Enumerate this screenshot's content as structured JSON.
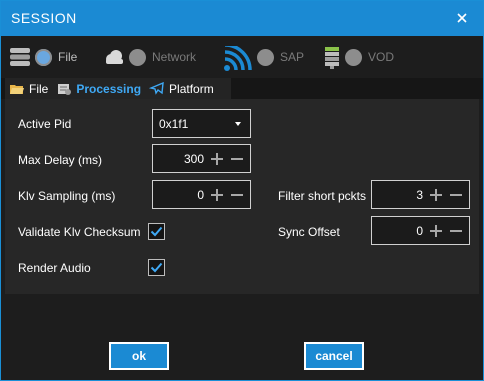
{
  "window": {
    "title": "SESSION",
    "accent": "#1b8ad3"
  },
  "sources": [
    {
      "icon": "database-icon",
      "label": "File",
      "selected": true
    },
    {
      "icon": "cloud-icon",
      "label": "Network",
      "selected": false
    },
    {
      "icon": "signal-icon",
      "label": "SAP",
      "selected": false
    },
    {
      "icon": "stack-icon",
      "label": "VOD",
      "selected": false
    }
  ],
  "tabs": [
    {
      "icon": "folder-icon",
      "label": "File",
      "selected": false
    },
    {
      "icon": "gear-icon",
      "label": "Processing",
      "selected": true
    },
    {
      "icon": "airplane-icon",
      "label": "Platform",
      "selected": false
    }
  ],
  "processing": {
    "active_pid": {
      "label": "Active Pid",
      "value": "0x1f1"
    },
    "max_delay": {
      "label": "Max Delay (ms)",
      "value": "300"
    },
    "klv_sampling": {
      "label": "Klv Sampling (ms)",
      "value": "0"
    },
    "filter_short": {
      "label": "Filter short pckts",
      "value": "3"
    },
    "validate_klv": {
      "label": "Validate Klv Checksum",
      "checked": true
    },
    "sync_offset": {
      "label": "Sync Offset",
      "value": "0"
    },
    "render_audio": {
      "label": "Render Audio",
      "checked": true
    }
  },
  "buttons": {
    "ok": "ok",
    "cancel": "cancel"
  }
}
